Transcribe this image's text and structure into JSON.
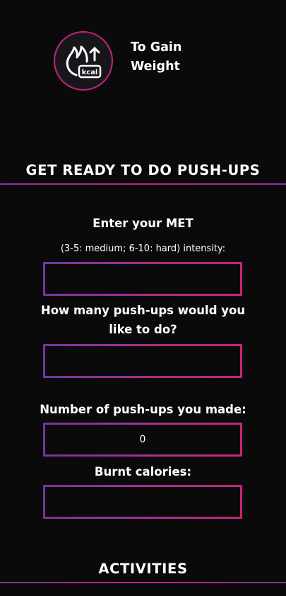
{
  "header": {
    "logo_icon": "kcal-flame-up-icon",
    "logo_text": "kcal",
    "title_line1": "To Gain",
    "title_line2": "Weight"
  },
  "pushups_section": {
    "heading": "GET READY TO DO PUSH-UPS",
    "met_label": "Enter your MET",
    "met_hint": "(3-5: medium; 6-10: hard) intensity:",
    "met_input": {
      "value": "",
      "placeholder": ""
    },
    "target_label_line1": "How many push-ups would you",
    "target_label_line2": "like to do?",
    "target_input": {
      "value": "",
      "placeholder": ""
    },
    "made_label": "Number of push-ups you made:",
    "made_value": "0",
    "burnt_label": "Burnt calories:",
    "burnt_value": ""
  },
  "activities_section": {
    "heading": "ACTIVITIES"
  },
  "colors": {
    "background": "#0a0a0a",
    "accent_purple": "#76359c",
    "accent_pink": "#c52577"
  }
}
